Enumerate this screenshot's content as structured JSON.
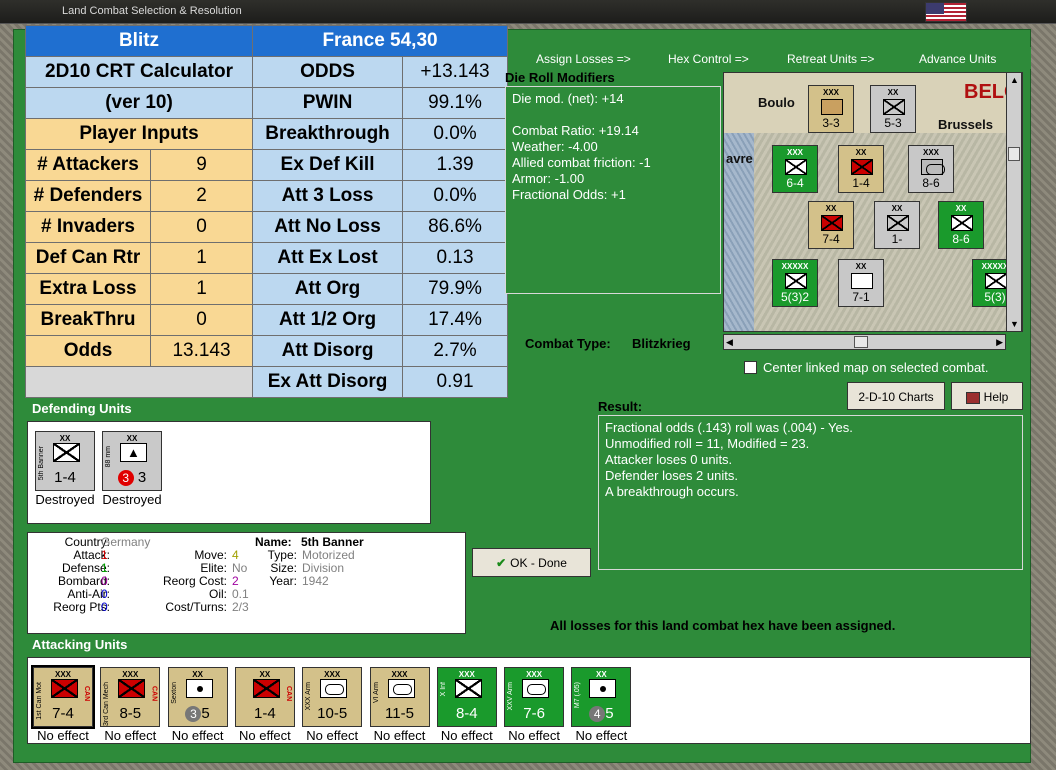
{
  "window": {
    "title": "Land Combat Selection & Resolution"
  },
  "crt": {
    "calc_title": "Blitz",
    "calc_name": "2D10 CRT Calculator",
    "calc_version": "(ver 10)",
    "player_inputs_header": "Player Inputs",
    "hex": "France 54,30",
    "inputs": [
      {
        "label": "# Attackers",
        "value": "9"
      },
      {
        "label": "# Defenders",
        "value": "2"
      },
      {
        "label": "# Invaders",
        "value": "0"
      },
      {
        "label": "Def Can Rtr",
        "value": "1"
      },
      {
        "label": "Extra Loss",
        "value": "1"
      },
      {
        "label": "BreakThru",
        "value": "0"
      }
    ],
    "odds_label": "Odds",
    "odds_value": "13.143",
    "results": [
      {
        "label": "ODDS",
        "value": "+13.143"
      },
      {
        "label": "PWIN",
        "value": "99.1%"
      },
      {
        "label": "Breakthrough",
        "value": "0.0%"
      },
      {
        "label": "Ex Def Kill",
        "value": "1.39"
      },
      {
        "label": "Att 3 Loss",
        "value": "0.0%"
      },
      {
        "label": "Att No Loss",
        "value": "86.6%"
      },
      {
        "label": "Att Ex Lost",
        "value": "0.13"
      },
      {
        "label": "Att Org",
        "value": "79.9%"
      },
      {
        "label": "Att 1/2 Org",
        "value": "17.4%"
      },
      {
        "label": "Att Disorg",
        "value": "2.7%"
      },
      {
        "label": "Ex Att Disorg",
        "value": "0.91"
      }
    ]
  },
  "phases": [
    "Assign Losses =>",
    "Hex Control =>",
    "Retreat Units =>",
    "Advance Units"
  ],
  "modifiers": {
    "header": "Die Roll Modifiers",
    "lines": [
      "Die mod. (net): +14",
      "",
      "Combat Ratio: +19.14",
      "Weather: -4.00",
      "Allied combat friction: -1",
      "Armor: -1.00",
      "Fractional Odds: +1"
    ]
  },
  "map": {
    "labels": [
      "Boulo",
      "BELG",
      "Brussels",
      "avre"
    ],
    "units": [
      {
        "str": "3-3"
      },
      {
        "str": "5-3"
      },
      {
        "str": "6-4"
      },
      {
        "str": "1-4"
      },
      {
        "str": "8-6"
      },
      {
        "str": "7-4"
      },
      {
        "str": "1-"
      },
      {
        "str": "8-6"
      },
      {
        "str": "5(3)2"
      },
      {
        "str": "7-1"
      },
      {
        "str": "5(3)"
      }
    ]
  },
  "combat_type": {
    "label": "Combat Type:",
    "value": "Blitzkrieg"
  },
  "center_linked": "Center linked map on selected combat.",
  "buttons": {
    "charts": "2-D-10 Charts",
    "help": "Help",
    "ok": "OK - Done"
  },
  "result": {
    "header": "Result:",
    "lines": [
      "Fractional odds (.143) roll was (.004)  - Yes.",
      "Unmodified roll = 11, Modified = 23.",
      "Attacker loses 0 units.",
      "Defender loses 2 units.",
      "A breakthrough occurs."
    ]
  },
  "defending": {
    "header": "Defending Units",
    "units": [
      {
        "size": "XX",
        "side": "5th Banner",
        "str": "1-4",
        "status": "Destroyed"
      },
      {
        "size": "XX",
        "side": "88 mm",
        "str": "3",
        "badge": "3",
        "status": "Destroyed"
      }
    ]
  },
  "details": {
    "left": [
      {
        "k": "Country:",
        "v": "Germany",
        "c": "#808080"
      },
      {
        "k": "Attack:",
        "v": "1",
        "c": "#d00000"
      },
      {
        "k": "Defense:",
        "v": "1",
        "c": "#00a000"
      },
      {
        "k": "Bombard:",
        "v": "0",
        "c": "#a000a0"
      },
      {
        "k": "Anti-Air:",
        "v": "0",
        "c": "#0000d0"
      },
      {
        "k": "Reorg Pts:",
        "v": "0",
        "c": "#0000d0"
      }
    ],
    "mid": [
      {
        "k": "Move:",
        "v": "4",
        "c": "#a0a000"
      },
      {
        "k": "Elite:",
        "v": "No",
        "c": "#808080"
      },
      {
        "k": "Reorg Cost:",
        "v": "2",
        "c": "#a000a0"
      },
      {
        "k": "Oil:",
        "v": "0.1",
        "c": "#808080"
      },
      {
        "k": "Cost/Turns:",
        "v": "2/3",
        "c": "#808080"
      }
    ],
    "name_label": "Name:",
    "name_value": "5th Banner",
    "right": [
      {
        "k": "Type:",
        "v": "Motorized"
      },
      {
        "k": "Size:",
        "v": "Division"
      },
      {
        "k": "Year:",
        "v": "1942"
      }
    ]
  },
  "all_losses": "All losses for this land combat hex have been assigned.",
  "attacking": {
    "header": "Attacking Units",
    "units": [
      {
        "size": "XXX",
        "side": "1st Can Mot",
        "tag": "CAN",
        "str": "7-4",
        "status": "No effect",
        "style": "tan",
        "sym": "redinf"
      },
      {
        "size": "XXX",
        "side": "3rd Can Mech",
        "tag": "CAN",
        "str": "8-5",
        "status": "No effect",
        "style": "tan",
        "sym": "redinf"
      },
      {
        "size": "XX",
        "side": "Sexton",
        "tag": "",
        "str": "5",
        "badge": "3",
        "status": "No effect",
        "style": "tan",
        "sym": "dot"
      },
      {
        "size": "XX",
        "side": "",
        "tag": "CAN",
        "str": "1-4",
        "status": "No effect",
        "style": "tan",
        "sym": "redinf"
      },
      {
        "size": "XXX",
        "side": "XXX Arm",
        "tag": "",
        "str": "10-5",
        "status": "No effect",
        "style": "tan",
        "sym": "arm"
      },
      {
        "size": "XXX",
        "side": "VI Arm",
        "tag": "",
        "str": "11-5",
        "status": "No effect",
        "style": "tan",
        "sym": "arm"
      },
      {
        "size": "XXX",
        "side": "X Inf",
        "tag": "",
        "str": "8-4",
        "status": "No effect",
        "style": "green",
        "sym": "inf"
      },
      {
        "size": "XXX",
        "side": "XXV Arm",
        "tag": "",
        "str": "7-6",
        "status": "No effect",
        "style": "green",
        "sym": "arm"
      },
      {
        "size": "XX",
        "side": "M7 (.05)",
        "tag": "",
        "str": "5",
        "badge": "4",
        "status": "No effect",
        "style": "green",
        "sym": "dot"
      }
    ]
  },
  "colors": {
    "panel_green": "#2e8b3a",
    "header_blue": "#1f6fd0",
    "input_orange": "#f9d894",
    "result_lightblue": "#bcd8f0"
  }
}
